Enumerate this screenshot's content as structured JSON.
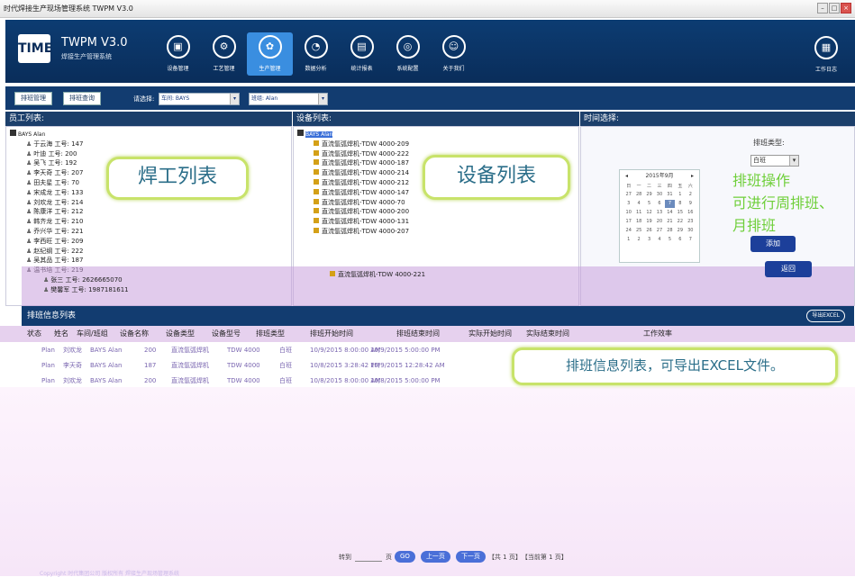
{
  "window": {
    "title": "时代焊接生产现场管理系统 TWPM V3.0"
  },
  "header": {
    "logo_text": "TIME",
    "app_title": "TWPM V3.0",
    "app_subtitle": "焊接生产管理系统",
    "nav": [
      {
        "label": "设备管理",
        "icon": "monitor-icon"
      },
      {
        "label": "工艺管理",
        "icon": "process-icon"
      },
      {
        "label": "生产管理",
        "icon": "production-icon",
        "active": true
      },
      {
        "label": "数据分析",
        "icon": "analysis-icon"
      },
      {
        "label": "统计报表",
        "icon": "report-icon"
      },
      {
        "label": "系统配置",
        "icon": "settings-icon"
      },
      {
        "label": "关于我们",
        "icon": "about-icon"
      }
    ],
    "log_label": "工作日志"
  },
  "toolbar": {
    "btn_schedule_mgmt": "排班管理",
    "btn_schedule_query": "排班查询",
    "select_label": "请选择:",
    "workshop_value": "车间: BAYS",
    "team_value": "班组: Alan"
  },
  "sections": {
    "employees": "员工列表:",
    "equipment": "设备列表:",
    "time": "时间选择:"
  },
  "employee_tree": {
    "root": "BAYS Alan",
    "items": [
      "于云海 工号: 147",
      "叶迪 工号: 200",
      "吴飞 工号: 192",
      "李天奇 工号: 207",
      "田夫星 工号: 70",
      "宋成龙 工号: 133",
      "刘欢龙 工号: 214",
      "陈康洋 工号: 212",
      "韩齐龙 工号: 210",
      "乔兴华 工号: 221",
      "李西旺 工号: 209",
      "赵纪纲 工号: 222",
      "吴其品 工号: 187",
      "温书培 工号: 219",
      "张三 工号: 2626665070",
      "樊馨军 工号: 1987181611"
    ]
  },
  "equipment_tree": {
    "root": "BAYS Alan",
    "items": [
      "直流氩弧焊机-TDW 4000-209",
      "直流氩弧焊机-TDW 4000-222",
      "直流氩弧焊机-TDW 4000-187",
      "直流氩弧焊机-TDW 4000-214",
      "直流氩弧焊机-TDW 4000-212",
      "直流氩弧焊机-TDW 4000-147",
      "直流氩弧焊机-TDW 4000-70",
      "直流氩弧焊机-TDW 4000-200",
      "直流氩弧焊机-TDW 4000-131",
      "直流氩弧焊机-TDW 4000-207",
      "直流氩弧焊机-TDW 4000-221"
    ]
  },
  "callouts": {
    "welders": "焊工列表",
    "equipment": "设备列表",
    "schedule": "排班操作\n可进行周排班、\n月排班",
    "export": "排班信息列表，可导出EXCEL文件。"
  },
  "schedule_panel": {
    "type_label": "排班类型:",
    "type_value": "白班",
    "add_button": "添加",
    "back_button": "返回",
    "calendar": {
      "title": "2015年9月",
      "weekdays": [
        "日",
        "一",
        "二",
        "三",
        "四",
        "五",
        "六"
      ],
      "days": [
        "27",
        "28",
        "29",
        "30",
        "31",
        "1",
        "2",
        "3",
        "4",
        "5",
        "6",
        "7",
        "8",
        "9",
        "10",
        "11",
        "12",
        "13",
        "14",
        "15",
        "16",
        "17",
        "18",
        "19",
        "20",
        "21",
        "22",
        "23",
        "24",
        "25",
        "26",
        "27",
        "28",
        "29",
        "30",
        "1",
        "2",
        "3",
        "4",
        "5",
        "6",
        "7"
      ],
      "selected_index": 11
    }
  },
  "schedule_list": {
    "title": "排班信息列表",
    "export_label": "导出EXCEL",
    "columns": [
      "状态",
      "姓名",
      "车间/班组",
      "设备名称",
      "设备类型",
      "设备型号",
      "排班类型",
      "排班开始时间",
      "排班结束时间",
      "实际开始时间",
      "实际结束时间",
      "工作效率"
    ],
    "rows": [
      [
        "Plan",
        "刘欢龙",
        "BAYS Alan",
        "200",
        "直流氩弧焊机",
        "TDW 4000",
        "白班",
        "10/9/2015 8:00:00 AM",
        "10/9/2015 5:00:00 PM"
      ],
      [
        "Plan",
        "李天奇",
        "BAYS Alan",
        "187",
        "直流氩弧焊机",
        "TDW 4000",
        "白班",
        "10/8/2015 3:28:42 PM",
        "10/9/2015 12:28:42 AM"
      ],
      [
        "Plan",
        "刘欢龙",
        "BAYS Alan",
        "200",
        "直流氩弧焊机",
        "TDW 4000",
        "白班",
        "10/8/2015 8:00:00 AM",
        "10/8/2015 5:00:00 PM"
      ]
    ]
  },
  "pager": {
    "goto_label": "转到",
    "page_unit": "页",
    "go_btn": "GO",
    "prev_btn": "上一页",
    "next_btn": "下一页",
    "total": "【共 1 页】",
    "current": "【当前第 1 页】"
  },
  "footer": "Copyright 时代集团公司 版权所有 焊接生产现场管理系统"
}
